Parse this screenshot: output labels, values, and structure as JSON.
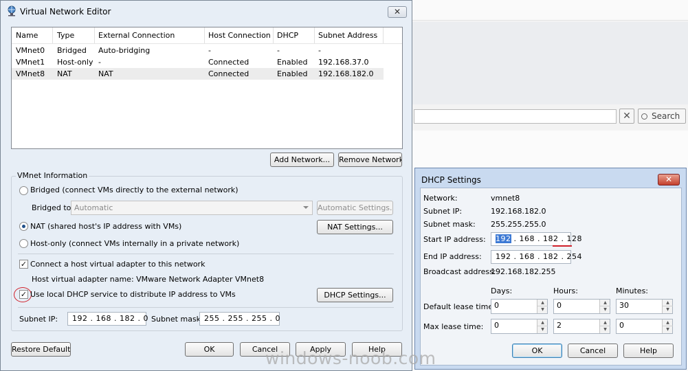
{
  "background_app": {
    "search_label": "Search"
  },
  "vne": {
    "title": "Virtual Network Editor",
    "close_glyph": "✕",
    "columns": [
      "Name",
      "Type",
      "External Connection",
      "Host Connection",
      "DHCP",
      "Subnet Address"
    ],
    "rows": [
      {
        "name": "VMnet0",
        "type": "Bridged",
        "external": "Auto-bridging",
        "host": "-",
        "dhcp": "-",
        "subnet": "-"
      },
      {
        "name": "VMnet1",
        "type": "Host-only",
        "external": "-",
        "host": "Connected",
        "dhcp": "Enabled",
        "subnet": "192.168.37.0"
      },
      {
        "name": "VMnet8",
        "type": "NAT",
        "external": "NAT",
        "host": "Connected",
        "dhcp": "Enabled",
        "subnet": "192.168.182.0"
      }
    ],
    "add_network": "Add Network...",
    "remove_network": "Remove Network",
    "vmnet_info_title": "VMnet Information",
    "bridged_option": "Bridged (connect VMs directly to the external network)",
    "bridged_to_label": "Bridged to:",
    "bridged_to_value": "Automatic",
    "automatic_settings": "Automatic Settings...",
    "nat_option": "NAT (shared host's IP address with VMs)",
    "nat_settings": "NAT Settings...",
    "hostonly_option": "Host-only (connect VMs internally in a private network)",
    "connect_adapter": "Connect a host virtual adapter to this network",
    "adapter_name": "Host virtual adapter name: VMware Network Adapter VMnet8",
    "use_dhcp": "Use local DHCP service to distribute IP address to VMs",
    "dhcp_settings": "DHCP Settings...",
    "subnet_ip_label": "Subnet IP:",
    "subnet_ip_value": "192 . 168 . 182 .  0",
    "subnet_mask_label": "Subnet mask:",
    "subnet_mask_value": "255 . 255 . 255 .  0",
    "restore_default": "Restore Default",
    "ok": "OK",
    "cancel": "Cancel",
    "apply": "Apply",
    "help": "Help",
    "selected_mode": "nat",
    "connect_adapter_checked": true,
    "use_dhcp_checked": true
  },
  "dhcp": {
    "title": "DHCP Settings",
    "close_glyph": "✕",
    "network_label": "Network:",
    "network_value": "vmnet8",
    "subnet_ip_label": "Subnet IP:",
    "subnet_ip_value": "192.168.182.0",
    "subnet_mask_label": "Subnet mask:",
    "subnet_mask_value": "255.255.255.0",
    "start_ip_label": "Start IP address:",
    "start_ip_parts": [
      "192",
      "168",
      "182",
      "128"
    ],
    "end_ip_label": "End IP address:",
    "end_ip_value": "192 . 168 . 182 . 254",
    "broadcast_label": "Broadcast address:",
    "broadcast_value": "192.168.182.255",
    "days_label": "Days:",
    "hours_label": "Hours:",
    "minutes_label": "Minutes:",
    "default_lease_label": "Default lease time:",
    "default_lease": {
      "days": "0",
      "hours": "0",
      "minutes": "30"
    },
    "max_lease_label": "Max lease time:",
    "max_lease": {
      "days": "0",
      "hours": "2",
      "minutes": "0"
    },
    "ok": "OK",
    "cancel": "Cancel",
    "help": "Help"
  },
  "watermark": "windows-noob.com",
  "colors": {
    "window_bg": "#e7eef6",
    "dhcp_frame": "#c9daf0",
    "annotation_red": "#d0202a",
    "selection_blue": "#3c79d4"
  }
}
